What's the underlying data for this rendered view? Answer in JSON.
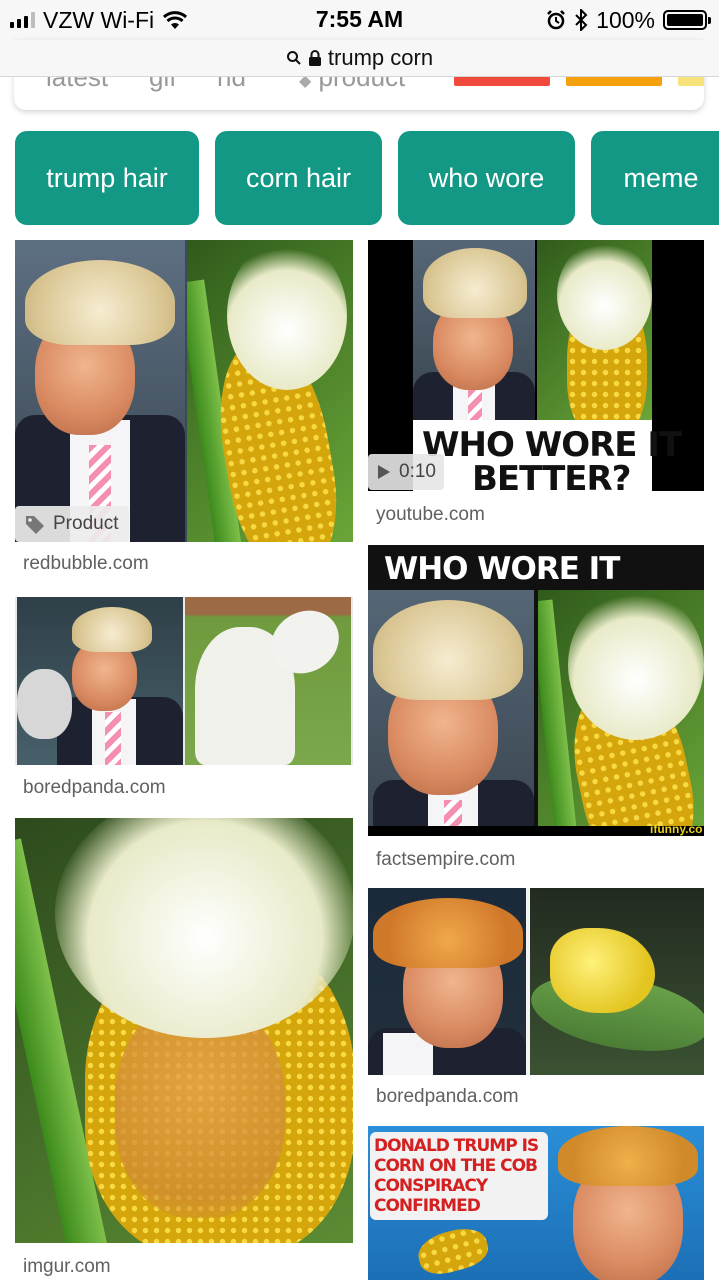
{
  "status": {
    "carrier": "VZW Wi-Fi",
    "time": "7:55 AM",
    "battery_percent": "100%",
    "battery_level": 1.0,
    "icons": [
      "signal-icon",
      "wifi-icon",
      "alarm-icon",
      "bluetooth-icon",
      "battery-icon"
    ]
  },
  "url": {
    "text": "trump corn",
    "icons": [
      "search-icon",
      "lock-icon"
    ]
  },
  "filters": {
    "items": [
      "latest",
      "gif",
      "hd",
      "product"
    ],
    "color_swatches": [
      "#ef4a3c",
      "#f5a00d",
      "#f7e27c"
    ]
  },
  "chips": [
    "trump hair",
    "corn hair",
    "who wore",
    "meme"
  ],
  "colors": {
    "chip_bg": "#129884"
  },
  "results": {
    "r1": {
      "source": "redbubble.com",
      "badge": "Product"
    },
    "r2": {
      "source": "boredpanda.com"
    },
    "r3": {
      "source": "imgur.com"
    },
    "r4": {
      "source": "youtube.com",
      "duration": "0:10",
      "caption_line1": "WHO WORE IT",
      "caption_line2": "BETTER?"
    },
    "r5": {
      "source": "factsempire.com",
      "caption": "WHO WORE IT BETTER?",
      "watermark": "ifunny.co"
    },
    "r6": {
      "source": "boredpanda.com"
    },
    "r7": {
      "caption_lines": [
        "DONALD TRUMP IS",
        "CORN ON THE COB",
        "CONSPIRACY",
        "CONFIRMED"
      ]
    }
  }
}
